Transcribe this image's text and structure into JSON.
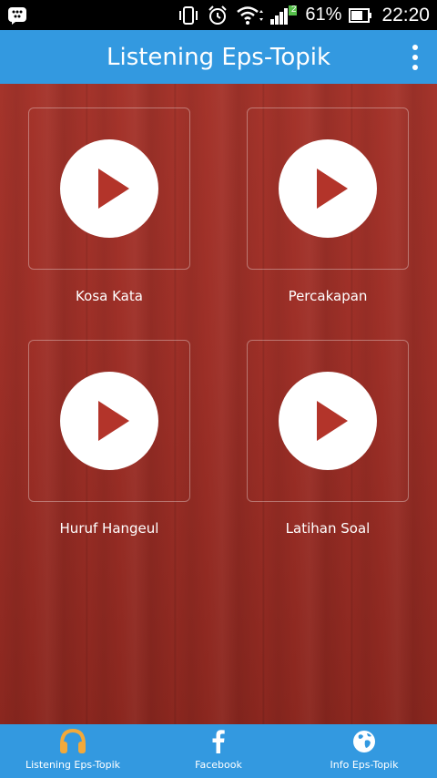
{
  "status_bar": {
    "battery_percent": "61%",
    "time": "22:20",
    "signal_badge": "2",
    "icons": [
      "bbm-icon",
      "vibrate-icon",
      "alarm-icon",
      "wifi-icon",
      "signal-icon",
      "battery-icon"
    ]
  },
  "app_bar": {
    "title": "Listening Eps-Topik",
    "overflow_icon": "more-vert-icon"
  },
  "tiles": [
    {
      "label": "Kosa Kata",
      "icon": "play-icon"
    },
    {
      "label": "Percakapan",
      "icon": "play-icon"
    },
    {
      "label": "Huruf Hangeul",
      "icon": "play-icon"
    },
    {
      "label": "Latihan Soal",
      "icon": "play-icon"
    }
  ],
  "bottom_nav": [
    {
      "label": "Listening Eps-Topik",
      "icon": "headphones-icon"
    },
    {
      "label": "Facebook",
      "icon": "facebook-icon"
    },
    {
      "label": "Info Eps-Topik",
      "icon": "globe-icon"
    }
  ],
  "colors": {
    "accent": "#3399e0",
    "wood": "#9d2f27",
    "play_triangle": "#b3342a",
    "headphones": "#f2a93b"
  }
}
